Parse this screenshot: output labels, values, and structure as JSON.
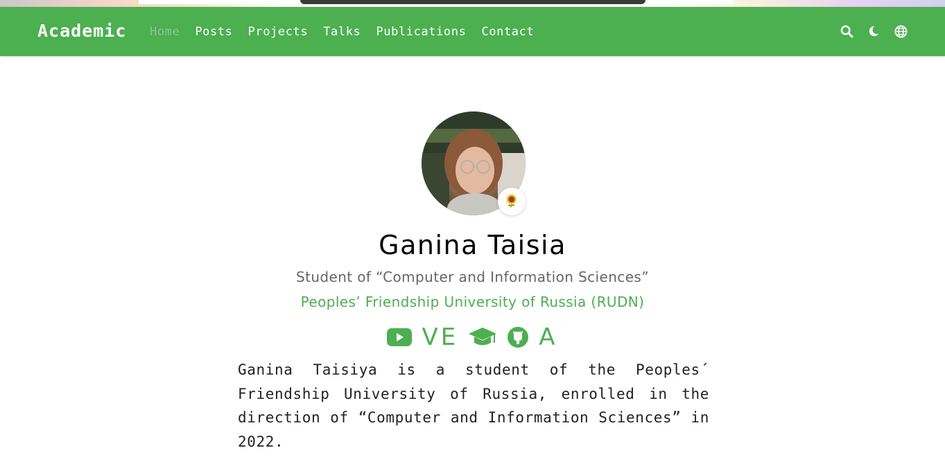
{
  "brand": "Academic",
  "nav": {
    "items": [
      {
        "label": "Home",
        "active": true
      },
      {
        "label": "Posts",
        "active": false
      },
      {
        "label": "Projects",
        "active": false
      },
      {
        "label": "Talks",
        "active": false
      },
      {
        "label": "Publications",
        "active": false
      },
      {
        "label": "Contact",
        "active": false
      }
    ],
    "icons": [
      "search-icon",
      "moon-icon",
      "globe-icon"
    ]
  },
  "profile": {
    "avatar_badge": "🌻",
    "name": "Ganina Taisia",
    "role": "Student of “Computer and Information Sciences”",
    "organization": "Peoples’ Friendship University of Russia (RUDN)",
    "socials": [
      {
        "icon": "youtube-icon"
      },
      {
        "text": "VE"
      },
      {
        "icon": "graduation-cap-icon"
      },
      {
        "icon": "github-icon"
      },
      {
        "text": "A"
      }
    ],
    "bio": "Ganina Taisiya is a student of the Peoples´ Friendship University of Russia, enrolled in the direction of “Computer and Information Sciences” in 2022."
  },
  "colors": {
    "accent": "#4caf50",
    "nav_active": "#8fc491",
    "text": "#222222",
    "muted": "#666666"
  }
}
